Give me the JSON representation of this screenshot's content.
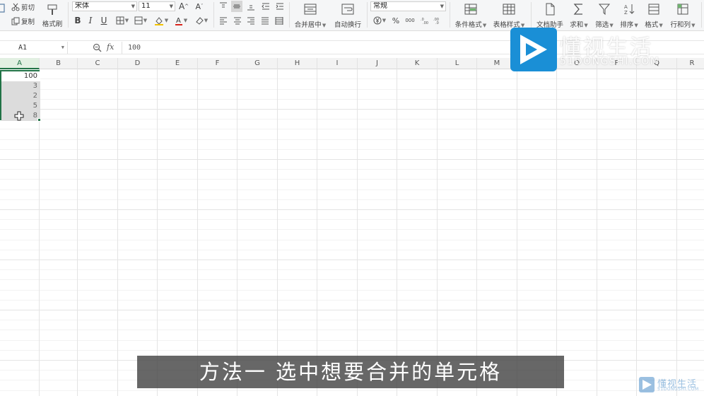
{
  "ribbon": {
    "clipboard": {
      "cut_label": "剪切",
      "copy_label": "复制",
      "format_painter_label": "格式刷"
    },
    "font": {
      "family": "宋体",
      "size": "11",
      "bold": "B",
      "italic": "I",
      "underline": "U"
    },
    "alignment": {
      "merge_center_label": "合并居中",
      "wrap_text_label": "自动换行"
    },
    "number": {
      "format": "常规",
      "percent": "%",
      "thousands": "000"
    },
    "styles": {
      "conditional_format_label": "条件格式",
      "table_style_label": "表格样式"
    },
    "tools": {
      "doc_helper_label": "文档助手",
      "sum_label": "求和",
      "filter_label": "筛选",
      "sort_label": "排序",
      "format_label": "格式",
      "rows_cols_label": "行和列"
    }
  },
  "formula_bar": {
    "name_box": "A1",
    "fx_label": "fx",
    "value": "100"
  },
  "sheet": {
    "columns": [
      "A",
      "B",
      "C",
      "D",
      "E",
      "F",
      "G",
      "H",
      "I",
      "J",
      "K",
      "L",
      "M",
      "N",
      "O",
      "P",
      "Q",
      "R"
    ],
    "selected_column": "A",
    "cells": [
      {
        "ref": "A1",
        "value": "100"
      },
      {
        "ref": "A2",
        "value": "3"
      },
      {
        "ref": "A3",
        "value": "2"
      },
      {
        "ref": "A4",
        "value": "5"
      },
      {
        "ref": "A5",
        "value": "8"
      }
    ]
  },
  "watermark": {
    "title": "懂视生活",
    "subtitle": "51DONGSHI.COM"
  },
  "caption": "方法一 选中想要合并的单元格",
  "corner_logo": {
    "title": "懂视生活",
    "subtitle": "51DONGSHI.COM"
  },
  "colors": {
    "accent": "#217346",
    "watermark_blue": "#1a8fd6",
    "caption_bg": "#464646"
  }
}
